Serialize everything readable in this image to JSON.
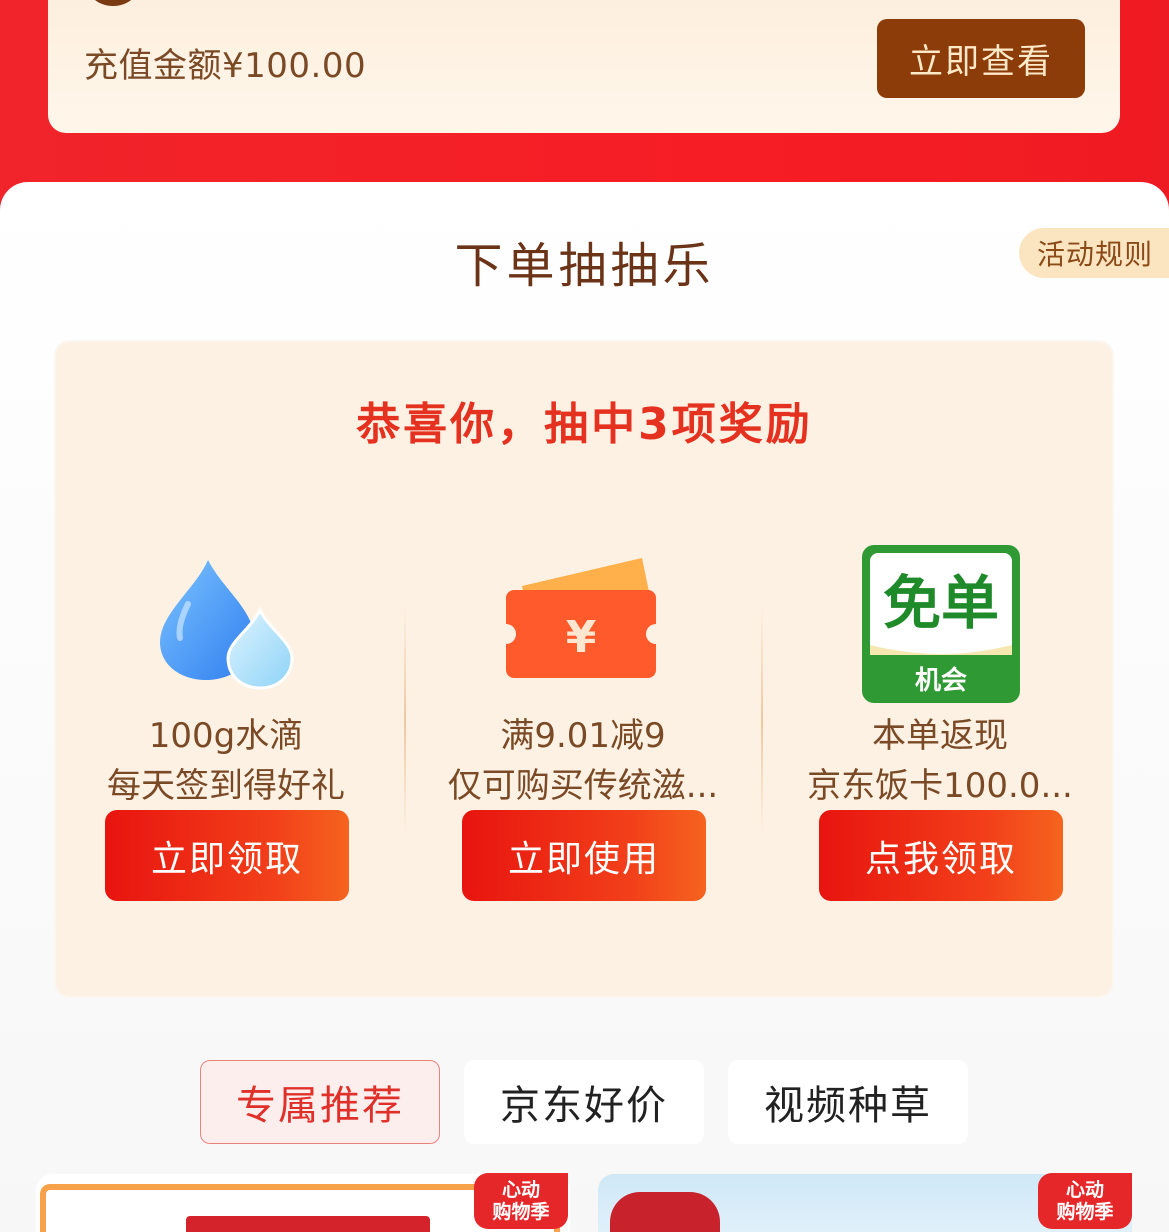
{
  "top_card": {
    "amount_text": "充值金额¥100.00",
    "view_button": "立即查看"
  },
  "section": {
    "title": "下单抽抽乐",
    "rules_button": "活动规则"
  },
  "prizes": {
    "congrats": "恭喜你，抽中3项奖励",
    "items": [
      {
        "icon": "water-drop-icon",
        "line1": "100g水滴",
        "line2": "每天签到得好礼",
        "button": "立即领取"
      },
      {
        "icon": "coupon-icon",
        "line1": "满9.01减9",
        "line2": "仅可购买传统滋...",
        "button": "立即使用",
        "coupon_symbol": "¥"
      },
      {
        "icon": "free-order-icon",
        "line1": "本单返现",
        "line2": "京东饭卡100.0...",
        "button": "点我领取",
        "icon_text_top": "免单",
        "icon_text_bottom": "机会"
      }
    ]
  },
  "tabs": [
    {
      "label": "专属推荐",
      "active": true
    },
    {
      "label": "京东好价",
      "active": false
    },
    {
      "label": "视频种草",
      "active": false
    }
  ],
  "products": [
    {
      "badge_l1": "心动",
      "badge_l2": "购物季"
    },
    {
      "badge_l1": "心动",
      "badge_l2": "购物季"
    }
  ],
  "colors": {
    "brand_red": "#f0242a",
    "accent_brown": "#8b3c08",
    "congrats_red": "#e5311f"
  }
}
